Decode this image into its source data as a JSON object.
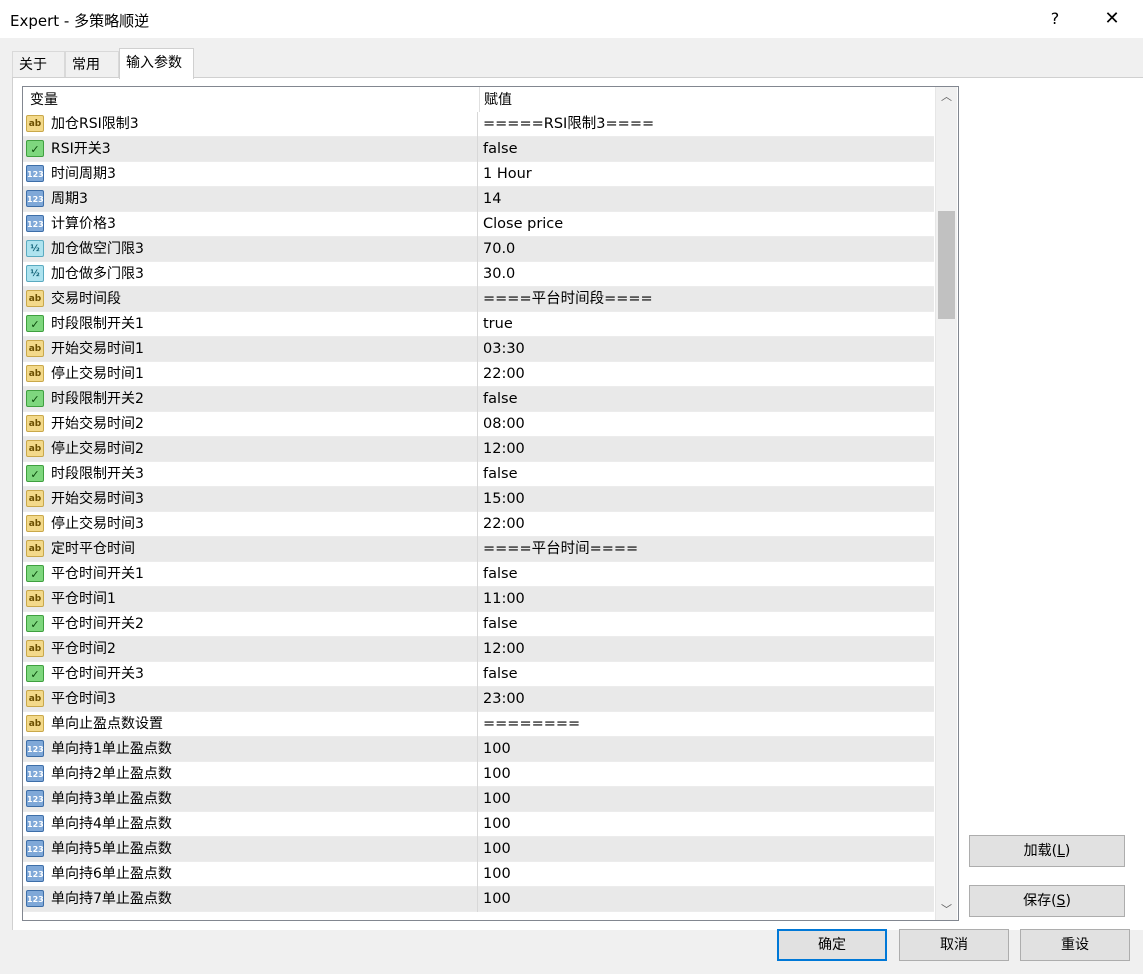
{
  "window": {
    "title": "Expert - 多策略顺逆",
    "help_label": "?",
    "close_label": "✕"
  },
  "tabs": [
    {
      "label": "关于"
    },
    {
      "label": "常用"
    },
    {
      "label": "输入参数"
    }
  ],
  "grid": {
    "headers": {
      "name": "变量",
      "value": "赋值"
    },
    "rows": [
      {
        "type": "ab",
        "name": "加仓RSI限制3",
        "value": "=====RSI限制3===="
      },
      {
        "type": "bool",
        "name": "RSI开关3",
        "value": "false"
      },
      {
        "type": "123",
        "name": "时间周期3",
        "value": "1 Hour"
      },
      {
        "type": "123",
        "name": "周期3",
        "value": "14"
      },
      {
        "type": "123",
        "name": "计算价格3",
        "value": "Close price"
      },
      {
        "type": "dbl",
        "name": "加仓做空门限3",
        "value": "70.0"
      },
      {
        "type": "dbl",
        "name": "加仓做多门限3",
        "value": "30.0"
      },
      {
        "type": "ab",
        "name": "交易时间段",
        "value": "====平台时间段===="
      },
      {
        "type": "bool",
        "name": "时段限制开关1",
        "value": "true"
      },
      {
        "type": "ab",
        "name": "开始交易时间1",
        "value": "03:30"
      },
      {
        "type": "ab",
        "name": "停止交易时间1",
        "value": "22:00"
      },
      {
        "type": "bool",
        "name": "时段限制开关2",
        "value": "false"
      },
      {
        "type": "ab",
        "name": "开始交易时间2",
        "value": "08:00"
      },
      {
        "type": "ab",
        "name": "停止交易时间2",
        "value": "12:00"
      },
      {
        "type": "bool",
        "name": "时段限制开关3",
        "value": "false"
      },
      {
        "type": "ab",
        "name": "开始交易时间3",
        "value": "15:00"
      },
      {
        "type": "ab",
        "name": "停止交易时间3",
        "value": "22:00"
      },
      {
        "type": "ab",
        "name": "定时平仓时间",
        "value": "====平台时间===="
      },
      {
        "type": "bool",
        "name": "平仓时间开关1",
        "value": "false"
      },
      {
        "type": "ab",
        "name": "平仓时间1",
        "value": "11:00"
      },
      {
        "type": "bool",
        "name": "平仓时间开关2",
        "value": "false"
      },
      {
        "type": "ab",
        "name": "平仓时间2",
        "value": "12:00"
      },
      {
        "type": "bool",
        "name": "平仓时间开关3",
        "value": "false"
      },
      {
        "type": "ab",
        "name": "平仓时间3",
        "value": "23:00"
      },
      {
        "type": "ab",
        "name": "单向止盈点数设置",
        "value": "========"
      },
      {
        "type": "123",
        "name": "单向持1单止盈点数",
        "value": "100"
      },
      {
        "type": "123",
        "name": "单向持2单止盈点数",
        "value": "100"
      },
      {
        "type": "123",
        "name": "单向持3单止盈点数",
        "value": "100"
      },
      {
        "type": "123",
        "name": "单向持4单止盈点数",
        "value": "100"
      },
      {
        "type": "123",
        "name": "单向持5单止盈点数",
        "value": "100"
      },
      {
        "type": "123",
        "name": "单向持6单止盈点数",
        "value": "100"
      },
      {
        "type": "123",
        "name": "单向持7单止盈点数",
        "value": "100"
      }
    ]
  },
  "icon_glyphs": {
    "ab": "ab",
    "123": "123",
    "bool": "✓",
    "dbl": "½"
  },
  "buttons": {
    "load": {
      "text": "加载(",
      "hotkey": "L",
      "suffix": ")"
    },
    "save": {
      "text": "保存(",
      "hotkey": "S",
      "suffix": ")"
    },
    "ok": "确定",
    "cancel": "取消",
    "reset": "重设"
  },
  "scrollbar": {
    "up_icon": "chevron-up-icon",
    "down_icon": "chevron-down-icon",
    "up_glyph": "︿",
    "down_glyph": "﹀"
  }
}
